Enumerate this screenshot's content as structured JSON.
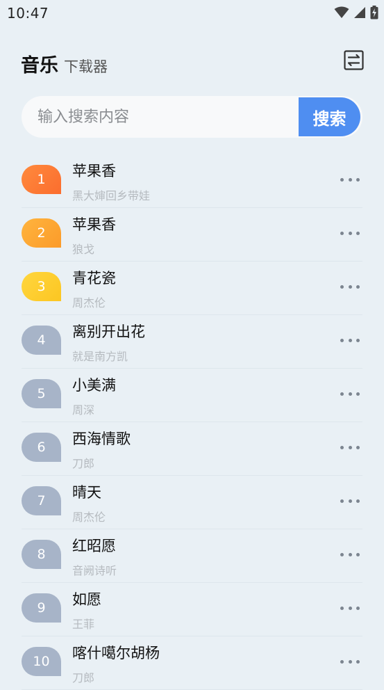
{
  "status_bar": {
    "time": "10:47"
  },
  "header": {
    "title": "音乐",
    "subtitle": "下载器",
    "switch_icon": "switch-icon"
  },
  "search": {
    "placeholder": "输入搜索内容",
    "value": "",
    "button_label": "搜索"
  },
  "colors": {
    "background": "#e9f0f5",
    "accent": "#4f8ef1",
    "rank1": "#fb6d2e",
    "rank2": "#fb9b2a",
    "rank3": "#fcc622",
    "rank_default": "#a7b4c8"
  },
  "songs": [
    {
      "rank": "1",
      "title": "苹果香",
      "artist": "黑大婶回乡带娃"
    },
    {
      "rank": "2",
      "title": "苹果香",
      "artist": "狼戈"
    },
    {
      "rank": "3",
      "title": "青花瓷",
      "artist": "周杰伦"
    },
    {
      "rank": "4",
      "title": "离别开出花",
      "artist": "就是南方凯"
    },
    {
      "rank": "5",
      "title": "小美满",
      "artist": "周深"
    },
    {
      "rank": "6",
      "title": "西海情歌",
      "artist": "刀郎"
    },
    {
      "rank": "7",
      "title": "晴天",
      "artist": "周杰伦"
    },
    {
      "rank": "8",
      "title": "红昭愿",
      "artist": "音阙诗听"
    },
    {
      "rank": "9",
      "title": "如愿",
      "artist": "王菲"
    },
    {
      "rank": "10",
      "title": "喀什噶尔胡杨",
      "artist": "刀郎"
    }
  ]
}
